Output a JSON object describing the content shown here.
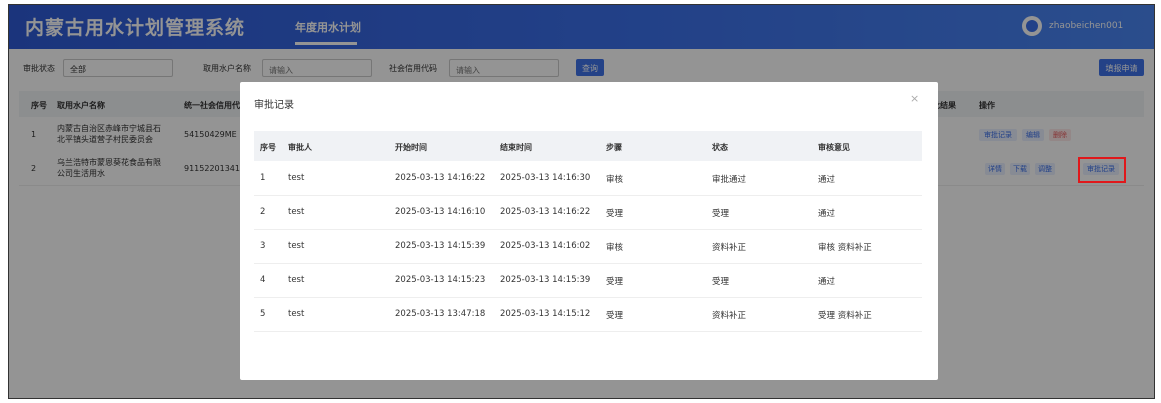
{
  "app": {
    "title": "内蒙古用水计划管理系统",
    "nav_tab": "年度用水计划",
    "username": "zhaobeichen001"
  },
  "filters": {
    "status_label": "审批状态",
    "status_value": "全部",
    "name_label": "取用水户名称",
    "name_placeholder": "请输入",
    "code_label": "社会信用代码",
    "code_placeholder": "请输入",
    "query_button": "查询",
    "apply_button": "填报申请"
  },
  "main_table": {
    "headers": [
      "序号",
      "取用水户名称",
      "统一社会信用代",
      "批结果",
      "操作"
    ],
    "rows": [
      {
        "index": "1",
        "name_line1": "内蒙古自治区赤峰市宁城县石",
        "name_line2": "北平镇头道营子村民委员会",
        "code": "54150429ME",
        "actions": [
          "审批记录",
          "编辑",
          "删除"
        ]
      },
      {
        "index": "2",
        "name_line1": "乌兰浩特市蒙恩葵花食品有限",
        "name_line2": "公司生活用水",
        "code": "91152201341",
        "actions": [
          "详情",
          "下载",
          "调整",
          "审批记录"
        ]
      }
    ]
  },
  "modal": {
    "title": "审批记录",
    "close_glyph": "×",
    "headers": [
      "序号",
      "审批人",
      "开始时间",
      "结束时间",
      "步骤",
      "状态",
      "审核意见"
    ],
    "rows": [
      [
        "1",
        "test",
        "2025-03-13 14:16:22",
        "2025-03-13 14:16:30",
        "审核",
        "审批通过",
        "通过"
      ],
      [
        "2",
        "test",
        "2025-03-13 14:16:10",
        "2025-03-13 14:16:22",
        "受理",
        "受理",
        "通过"
      ],
      [
        "3",
        "test",
        "2025-03-13 14:15:39",
        "2025-03-13 14:16:02",
        "审核",
        "资料补正",
        "审核 资料补正"
      ],
      [
        "4",
        "test",
        "2025-03-13 14:15:23",
        "2025-03-13 14:15:39",
        "受理",
        "受理",
        "通过"
      ],
      [
        "5",
        "test",
        "2025-03-13 13:47:18",
        "2025-03-13 14:15:12",
        "受理",
        "资料补正",
        "受理 资料补正"
      ]
    ]
  },
  "colors": {
    "primary": "#3c70ea",
    "highlight": "#e0181b",
    "danger": "#e8585b"
  }
}
